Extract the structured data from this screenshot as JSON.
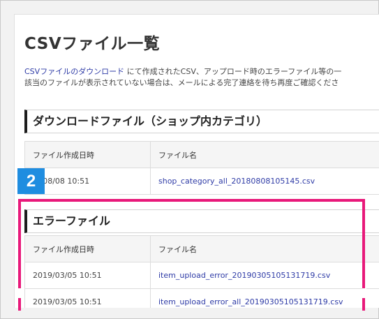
{
  "page": {
    "title": "CSVファイル一覧",
    "desc_link": "CSVファイルのダウンロード",
    "desc_line1_rest": " にて作成されたCSV、アップロード時のエラーファイル等の一",
    "desc_line2": "該当のファイルが表示されていない場合は、メールによる完了連絡を待ち再度ご確認くださ"
  },
  "badge": "2",
  "download_section": {
    "heading": "ダウンロードファイル（ショップ内カテゴリ）",
    "columns": [
      "ファイル作成日時",
      "ファイル名"
    ],
    "rows": [
      {
        "date": ".8/08/08 10:51",
        "file": "shop_category_all_20180808105145.csv"
      }
    ]
  },
  "error_section": {
    "heading": "エラーファイル",
    "columns": [
      "ファイル作成日時",
      "ファイル名"
    ],
    "rows": [
      {
        "date": "2019/03/05 10:51",
        "file": "item_upload_error_20190305105131719.csv"
      },
      {
        "date": "2019/03/05 10:51",
        "file": "item_upload_error_all_20190305105131719.csv"
      }
    ]
  },
  "colors": {
    "highlight": "#e8197a",
    "badge": "#1f8de0",
    "link": "#2e3ba6"
  }
}
